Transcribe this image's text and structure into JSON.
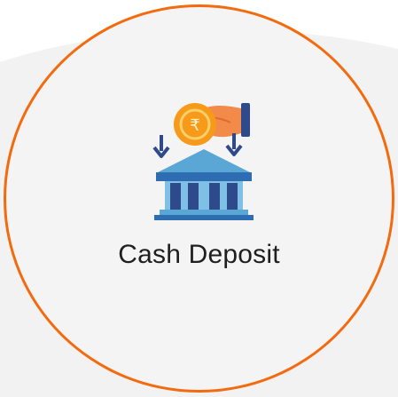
{
  "tile": {
    "label": "Cash Deposit",
    "icon": "cash-deposit-icon",
    "currency_symbol": "₹",
    "accent_color": "#f26b0f"
  }
}
